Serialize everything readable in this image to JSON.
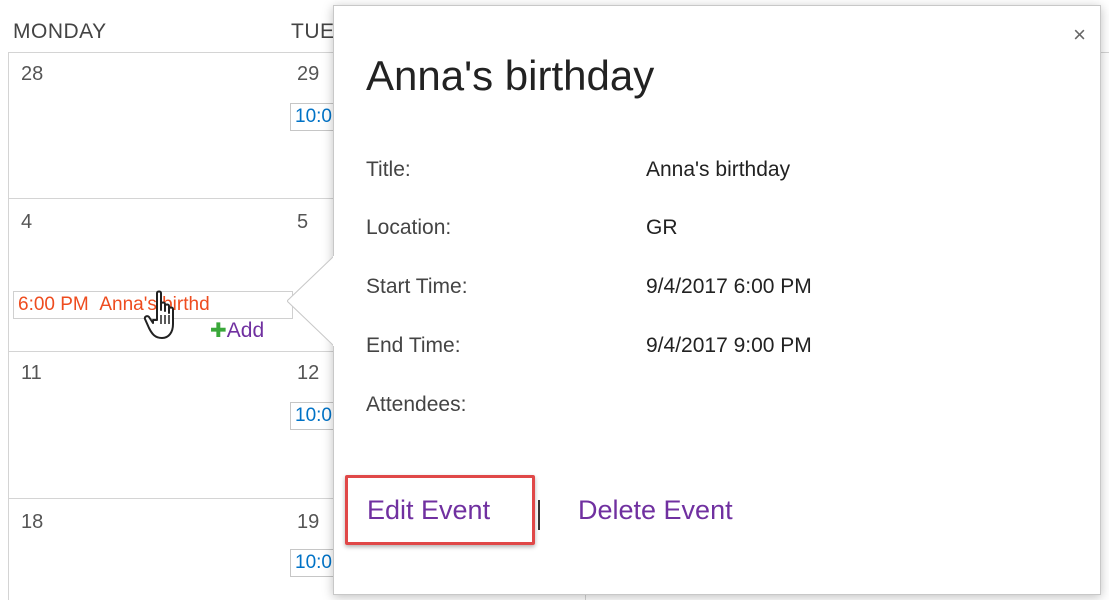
{
  "calendar": {
    "headers": {
      "monday": "MONDAY",
      "tuesday": "TUE"
    },
    "weeks": [
      {
        "monday": "28",
        "tuesday": "29",
        "tuesday_event": "10:0"
      },
      {
        "monday": "4",
        "tuesday": "5",
        "monday_event_time": "6:00 PM",
        "monday_event_title": "Anna's birthd",
        "add_label": "Add"
      },
      {
        "monday": "11",
        "tuesday": "12",
        "tuesday_event": "10:0"
      },
      {
        "monday": "18",
        "tuesday": "19",
        "tuesday_event": "10:0"
      }
    ]
  },
  "callout": {
    "close_symbol": "×",
    "title": "Anna's birthday",
    "fields": [
      {
        "label": "Title:",
        "value": "Anna's birthday"
      },
      {
        "label": "Location:",
        "value": "GR"
      },
      {
        "label": "Start Time:",
        "value": "9/4/2017 6:00 PM"
      },
      {
        "label": "End Time:",
        "value": "9/4/2017 9:00 PM"
      },
      {
        "label": "Attendees:",
        "value": ""
      }
    ],
    "actions": {
      "edit": "Edit Event",
      "delete": "Delete Event"
    }
  },
  "colors": {
    "accent_purple": "#7030a0",
    "event_blue": "#0072c6",
    "selected_event": "#ee4c1f",
    "highlight_red": "#e04848"
  },
  "icons": {
    "close": "close-icon",
    "cursor": "hand-pointer-icon",
    "add": "plus-icon"
  }
}
